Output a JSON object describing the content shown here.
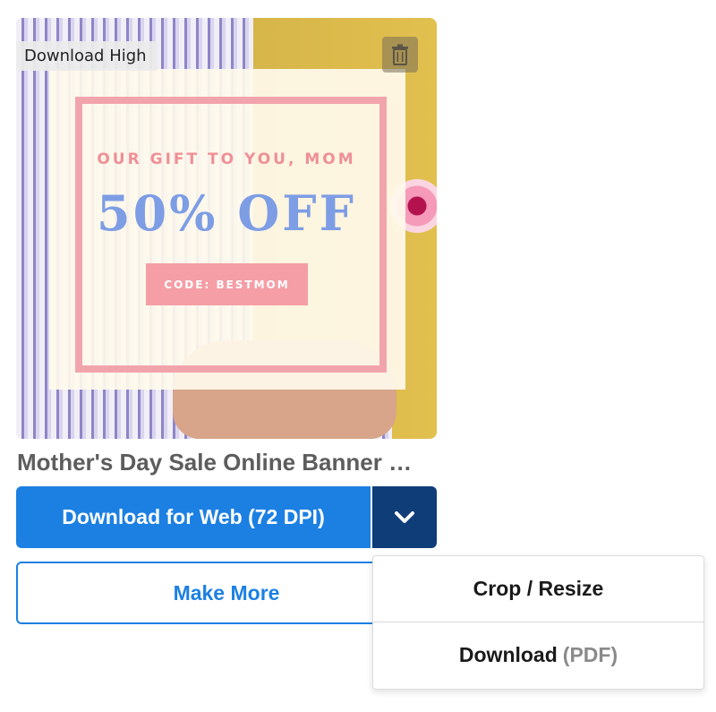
{
  "card": {
    "tooltip": "Download High",
    "thumbnail": {
      "headline": "OUR GIFT TO YOU, MOM",
      "offer": "50% OFF",
      "code": "CODE: BESTMOM"
    },
    "title": "Mother's Day Sale Online Banner …",
    "icons": {
      "trash": "trash-icon",
      "caret": "chevron-down-icon"
    }
  },
  "actions": {
    "download_label": "Download for Web (72 DPI)",
    "make_more_label": "Make More"
  },
  "dropdown": {
    "items": [
      {
        "label": "Crop / Resize",
        "suffix": ""
      },
      {
        "label": "Download",
        "suffix": "(PDF)"
      }
    ]
  },
  "colors": {
    "primary": "#1c80e2",
    "primary_dark": "#0f3d78",
    "offer_blue": "#7d9de4",
    "accent_pink": "#f2a4ad"
  }
}
